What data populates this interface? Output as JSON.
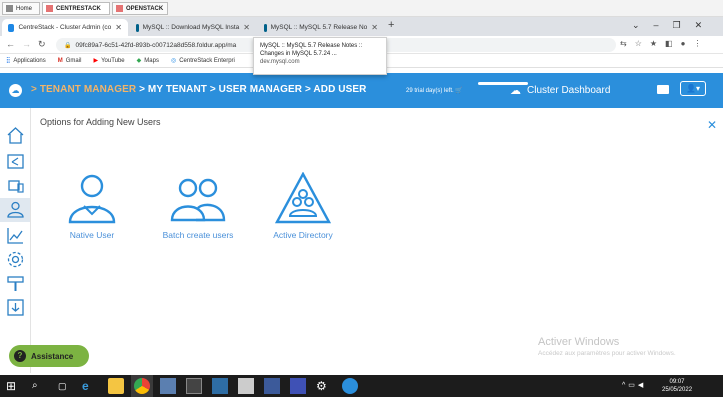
{
  "outer_tabs": [
    {
      "label": "Home"
    },
    {
      "label": "CENTRESTACK"
    },
    {
      "label": "OPENSTACK"
    }
  ],
  "browser_tabs": [
    {
      "label": "CentreStack - Cluster Admin (co",
      "fav": "#1e88e5"
    },
    {
      "label": "MySQL :: Download MySQL Insta",
      "fav": "#00618a"
    },
    {
      "label": "MySQL :: MySQL 5.7 Release No",
      "fav": "#00618a"
    }
  ],
  "new_tab_label": "+",
  "url": "09fc89a7-6c51-42fd-893b-c00712a8d558.foldur.app/ma",
  "bookmarks": [
    "Applications",
    "Gmail",
    "YouTube",
    "Maps",
    "CentreStack Enterpri"
  ],
  "tooltip": {
    "title": "MySQL :: MySQL 5.7 Release Notes :: Changes in MySQL 5.7.24 ...",
    "domain": "dev.mysql.com"
  },
  "header": {
    "crumb_first": "> TENANT MANAGER",
    "crumb_rest": "> MY TENANT > USER MANAGER > ADD USER",
    "trial": "29 trial day(s) left.",
    "dashboard": "Cluster Dashboard"
  },
  "main": {
    "heading": "Options for Adding New Users",
    "options": [
      {
        "label": "Native User"
      },
      {
        "label": "Batch create users"
      },
      {
        "label": "Active Directory"
      }
    ]
  },
  "assistance": "Assistance",
  "watermark": {
    "line1": "Activer Windows",
    "line2": "Accédez aux paramètres pour activer Windows."
  },
  "clock": {
    "time": "09:07",
    "date": "25/05/2022"
  },
  "colors": {
    "header": "#2b8fdc",
    "accent": "#f2b46a",
    "link": "#4a90d9",
    "assist": "#7cb342"
  }
}
